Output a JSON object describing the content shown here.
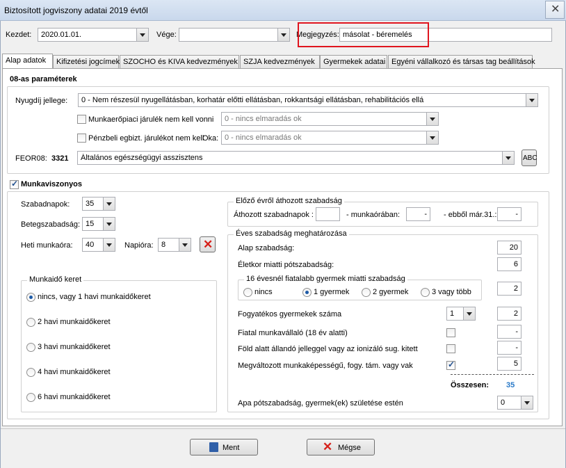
{
  "window": {
    "title": "Biztosított jogviszony adatai 2019 évtől"
  },
  "top": {
    "start_label": "Kezdet:",
    "start_value": "2020.01.01.",
    "end_label": "Vége:",
    "end_value": "",
    "note_label": "Megjegyzés:",
    "note_value": "másolat - béremelés"
  },
  "tabs": [
    "Alap adatok",
    "Kifizetési jogcímek",
    "SZOCHO és KIVA kedvezmények",
    "SZJA kedvezmények",
    "Gyermekek adatai",
    "Egyéni vállalkozó és társas tag beállítások"
  ],
  "params": {
    "heading": "08-as paraméterek",
    "pension_label": "Nyugdíj jellege:",
    "pension_value": "0 - Nem részesül nyugellátásban, korhatár előtti ellátásban, rokkantsági ellátásban, rehabilitációs ellá",
    "labor_chk_label": "Munkaerőpiaci járulék nem kell vonni",
    "labor_value": "0 - nincs elmaradás ok",
    "cash_chk_label": "Pénzbeli egbizt. járulékot nem kell",
    "reason_label": "Oka:",
    "reason_value": "0 - nincs elmaradás ok",
    "feor_label": "FEOR08:",
    "feor_code": "3321",
    "feor_value": "Általános egészségügyi asszisztens",
    "abc_label": "ABC"
  },
  "employment": {
    "label": "Munkaviszonyos",
    "vacation_label": "Szabadnapok:",
    "vacation_value": "35",
    "sick_label": "Betegszabadság:",
    "sick_value": "15",
    "weekly_label": "Heti munkaóra:",
    "weekly_value": "40",
    "daily_label": "Napióra:",
    "daily_value": "8"
  },
  "frame": {
    "legend": "Munkaidő keret",
    "options": [
      "nincs, vagy 1 havi munkaidőkeret",
      "2 havi munkaidőkeret",
      "3 havi munkaidőkeret",
      "4 havi munkaidőkeret",
      "6 havi munkaidőkeret"
    ],
    "selected": 0
  },
  "carry": {
    "legend": "Előző évről áthozott szabadság",
    "days_label": "Áthozott szabadnapok :",
    "hours_label": "- munkaórában:",
    "hours_value": "-",
    "by_label": "- ebből már.31.:",
    "by_value": "-"
  },
  "annual": {
    "legend": "Éves szabadság meghatározása",
    "base_label": "Alap szabadság:",
    "base_value": "20",
    "age_label": "Életkor miatti pótszabadság:",
    "age_value": "6",
    "children_legend": "16 évesnél fiatalabb gyermek miatti szabadság",
    "child_opts": [
      "nincs",
      "1 gyermek",
      "2 gyermek",
      "3 vagy több"
    ],
    "child_selected": 1,
    "child_value": "2",
    "disabled_children_label": "Fogyatékos gyermekek száma",
    "disabled_children_combo": "1",
    "disabled_children_value": "2",
    "young_label": "Fiatal munkavállaló (18 év alatti)",
    "young_value": "-",
    "underground_label": "Föld alatt állandó jelleggel vagy az ionizáló sug. kitett",
    "underground_value": "-",
    "reduced_label": "Megváltozott munkaképességű, fogy. tám. vagy vak",
    "reduced_value": "5",
    "total_label": "Összesen:",
    "total_value": "35",
    "father_label": "Apa pótszabadság, gyermek(ek) születése estén",
    "father_value": "0"
  },
  "buttons": {
    "save": "Ment",
    "cancel": "Mégse"
  },
  "colors": {
    "highlight": "#e0141e",
    "total": "#2a7ac8"
  }
}
